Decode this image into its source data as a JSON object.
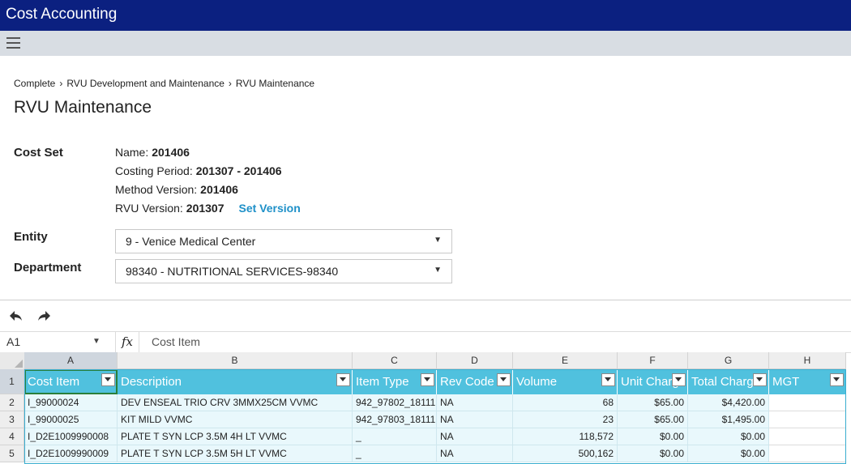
{
  "app": {
    "title": "Cost Accounting"
  },
  "breadcrumb": [
    "Complete",
    "RVU Development and Maintenance",
    "RVU Maintenance"
  ],
  "page_title": "RVU Maintenance",
  "cost_set": {
    "label": "Cost Set",
    "name_label": "Name:",
    "name_value": "201406",
    "period_label": "Costing Period:",
    "period_value": "201307 - 201406",
    "method_label": "Method Version:",
    "method_value": "201406",
    "rvu_label": "RVU Version:",
    "rvu_value": "201307",
    "set_version_link": "Set Version"
  },
  "entity": {
    "label": "Entity",
    "value": "9 - Venice Medical Center"
  },
  "department": {
    "label": "Department",
    "value": "98340 - NUTRITIONAL SERVICES-98340"
  },
  "toolbar": {
    "undo_icon": "undo-icon",
    "redo_icon": "redo-icon"
  },
  "formula_bar": {
    "cell_ref": "A1",
    "fx": "fx",
    "content": "Cost Item"
  },
  "sheet": {
    "columns": [
      "A",
      "B",
      "C",
      "D",
      "E",
      "F",
      "G",
      "H"
    ],
    "rows": [
      "1",
      "2",
      "3",
      "4",
      "5"
    ],
    "headers": [
      "Cost Item",
      "Description",
      "Item Type",
      "Rev Code",
      "Volume",
      "Unit Charge",
      "Total Charges",
      "MGT"
    ],
    "data": [
      [
        "I_99000024",
        "DEV ENSEAL TRIO CRV 3MMX25CM VVMC",
        "942_97802_18111",
        "NA",
        "68",
        "$65.00",
        "$4,420.00",
        ""
      ],
      [
        "I_99000025",
        "KIT MILD VVMC",
        "942_97803_18111",
        "NA",
        "23",
        "$65.00",
        "$1,495.00",
        ""
      ],
      [
        "I_D2E1009990008",
        "PLATE T SYN LCP 3.5M 4H LT VVMC",
        "_",
        "NA",
        "118,572",
        "$0.00",
        "$0.00",
        ""
      ],
      [
        "I_D2E1009990009",
        "PLATE T SYN LCP 3.5M 5H LT VVMC",
        "_",
        "NA",
        "500,162",
        "$0.00",
        "$0.00",
        ""
      ]
    ]
  },
  "colors": {
    "title_bar": "#0b2080",
    "table_header": "#50c1de",
    "row_fill": "#e9f8fc",
    "link": "#1e90c8"
  }
}
